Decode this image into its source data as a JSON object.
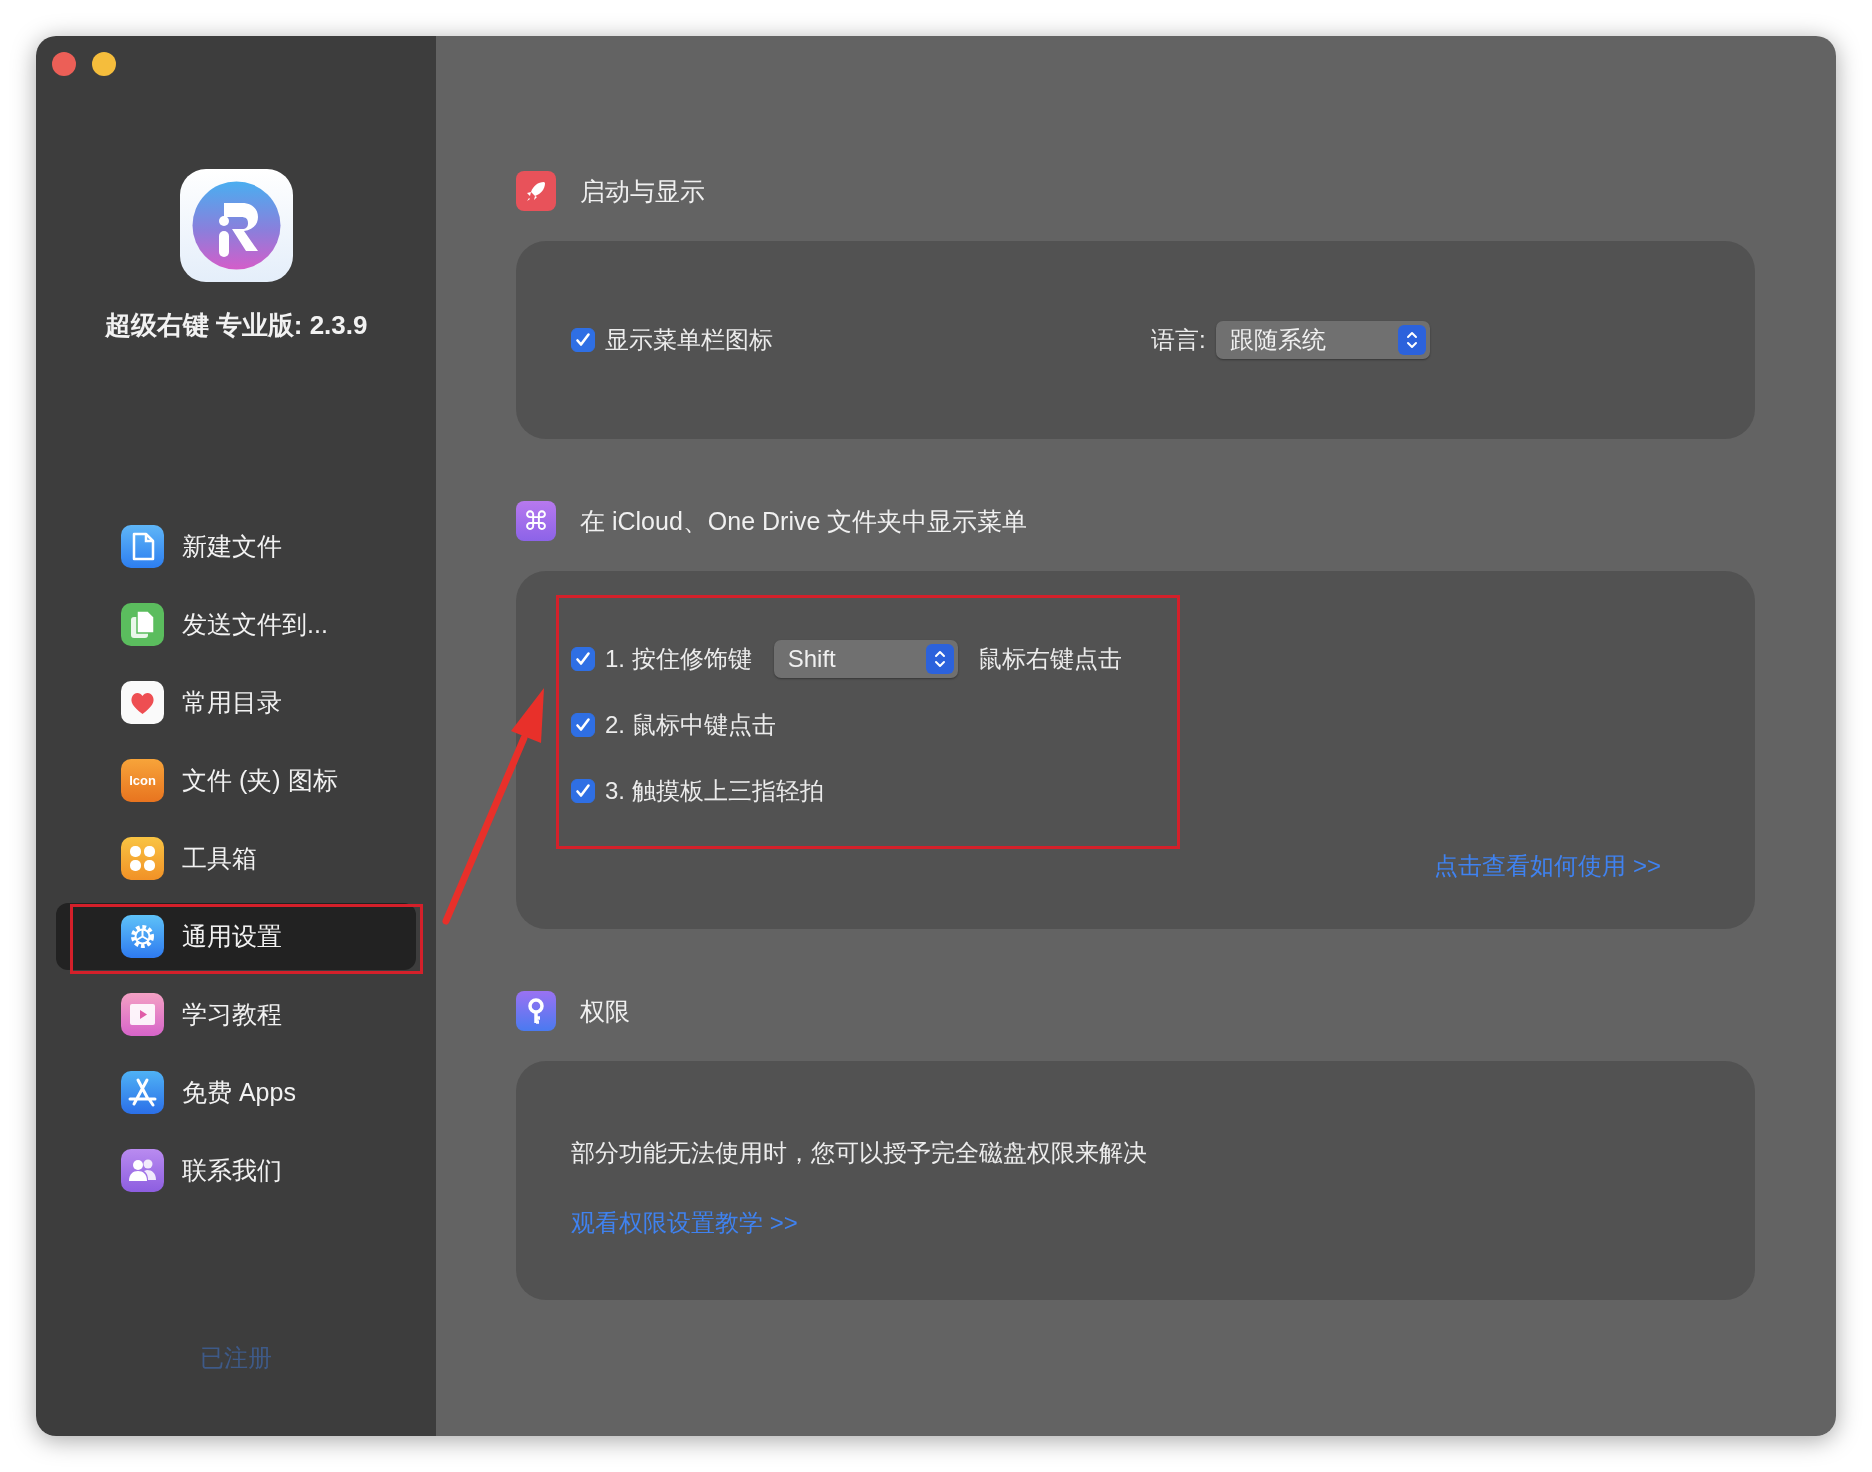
{
  "app": {
    "title": "超级右键 专业版: 2.3.9"
  },
  "sidebar": {
    "items": [
      {
        "label": "新建文件",
        "selected": false
      },
      {
        "label": "发送文件到...",
        "selected": false
      },
      {
        "label": "常用目录",
        "selected": false
      },
      {
        "label": "文件 (夹) 图标",
        "selected": false,
        "icon_text": "Icon"
      },
      {
        "label": "工具箱",
        "selected": false
      },
      {
        "label": "通用设置",
        "selected": true
      },
      {
        "label": "学习教程",
        "selected": false
      },
      {
        "label": "免费 Apps",
        "selected": false
      },
      {
        "label": "联系我们",
        "selected": false
      }
    ],
    "footer": "已注册"
  },
  "sections": [
    {
      "title": "启动与显示",
      "show_menubar_icon": {
        "label": "显示菜单栏图标",
        "checked": true
      },
      "language": {
        "label": "语言:",
        "value": "跟随系统"
      }
    },
    {
      "title": "在 iCloud、One Drive 文件夹中显示菜单",
      "icon_glyph": "⌘",
      "options": [
        {
          "kind": "modifier",
          "checked": true,
          "label": "1. 按住修饰键",
          "value": "Shift",
          "suffix": "鼠标右键点击"
        },
        {
          "kind": "plain",
          "checked": true,
          "label": "2. 鼠标中键点击"
        },
        {
          "kind": "plain",
          "checked": true,
          "label": "3. 触摸板上三指轻拍"
        }
      ],
      "link": "点击查看如何使用 >>"
    },
    {
      "title": "权限",
      "text": "部分功能无法使用时，您可以授予完全磁盘权限来解决",
      "link": "观看权限设置教学 >>"
    }
  ]
}
